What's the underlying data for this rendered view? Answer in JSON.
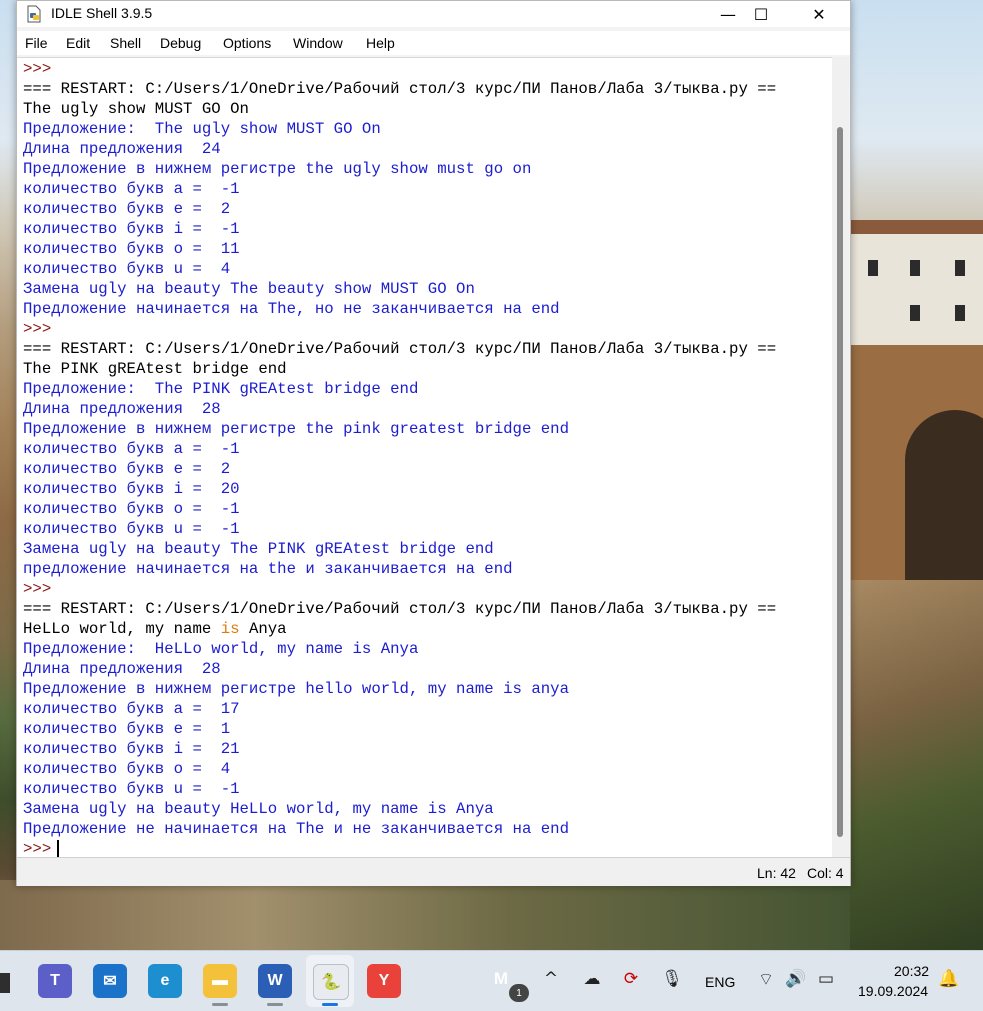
{
  "window": {
    "title": "IDLE Shell 3.9.5",
    "controls": {
      "minimize": "—",
      "maximize": "☐",
      "close": "✕"
    }
  },
  "menu": [
    "File",
    "Edit",
    "Shell",
    "Debug",
    "Options",
    "Window",
    "Help"
  ],
  "shell": {
    "lines": [
      {
        "type": "prompt",
        "text": ">>>"
      },
      {
        "type": "restart",
        "text": "=== RESTART: C:/Users/1/OneDrive/Рабочий стол/3 курс/ПИ Панов/Лаба 3/тыква.py =="
      },
      {
        "type": "input",
        "text": "The ugly show MUST GO On"
      },
      {
        "type": "out",
        "text": "Предложение:  The ugly show MUST GO On"
      },
      {
        "type": "out",
        "text": "Длина предложения  24"
      },
      {
        "type": "out",
        "text": "Предложение в нижнем регистре the ugly show must go on"
      },
      {
        "type": "out",
        "text": "количество букв а =  -1"
      },
      {
        "type": "out",
        "text": "количество букв е =  2"
      },
      {
        "type": "out",
        "text": "количество букв i =  -1"
      },
      {
        "type": "out",
        "text": "количество букв о =  11"
      },
      {
        "type": "out",
        "text": "количество букв u =  4"
      },
      {
        "type": "out",
        "text": "Замена ugly на beauty The beauty show MUST GO On"
      },
      {
        "type": "out",
        "text": "Предложение начинается на The, но не заканчивается на end"
      },
      {
        "type": "prompt",
        "text": ">>>"
      },
      {
        "type": "restart",
        "text": "=== RESTART: C:/Users/1/OneDrive/Рабочий стол/3 курс/ПИ Панов/Лаба 3/тыква.py =="
      },
      {
        "type": "input",
        "text": "The PINK gREAtest bridge end"
      },
      {
        "type": "out",
        "text": "Предложение:  The PINK gREAtest bridge end"
      },
      {
        "type": "out",
        "text": "Длина предложения  28"
      },
      {
        "type": "out",
        "text": "Предложение в нижнем регистре the pink greatest bridge end"
      },
      {
        "type": "out",
        "text": "количество букв а =  -1"
      },
      {
        "type": "out",
        "text": "количество букв е =  2"
      },
      {
        "type": "out",
        "text": "количество букв i =  20"
      },
      {
        "type": "out",
        "text": "количество букв о =  -1"
      },
      {
        "type": "out",
        "text": "количество букв u =  -1"
      },
      {
        "type": "out",
        "text": "Замена ugly на beauty The PINK gREAtest bridge end"
      },
      {
        "type": "out",
        "text": "предложение начинается на the и заканчивается на end"
      },
      {
        "type": "prompt",
        "text": ">>>"
      },
      {
        "type": "restart",
        "text": "=== RESTART: C:/Users/1/OneDrive/Рабочий стол/3 курс/ПИ Панов/Лаба 3/тыква.py =="
      },
      {
        "type": "input-kw",
        "before": "HeLLo world, my name ",
        "kw": "is",
        "after": " Anya"
      },
      {
        "type": "out",
        "text": "Предложение:  HeLLo world, my name is Anya"
      },
      {
        "type": "out",
        "text": "Длина предложения  28"
      },
      {
        "type": "out",
        "text": "Предложение в нижнем регистре hello world, my name is anya"
      },
      {
        "type": "out",
        "text": "количество букв а =  17"
      },
      {
        "type": "out",
        "text": "количество букв е =  1"
      },
      {
        "type": "out",
        "text": "количество букв i =  21"
      },
      {
        "type": "out",
        "text": "количество букв о =  4"
      },
      {
        "type": "out",
        "text": "количество букв u =  -1"
      },
      {
        "type": "out",
        "text": "Замена ugly на beauty HeLLo world, my name is Anya"
      },
      {
        "type": "out",
        "text": "Предложение не начинается на The и не заканчивается на end"
      },
      {
        "type": "prompt-cursor",
        "text": ">>>"
      }
    ]
  },
  "status": {
    "ln": "Ln: 42",
    "col": "Col: 4"
  },
  "taskbar": {
    "apps": [
      {
        "name": "teams-icon",
        "label": "T",
        "color": "#5b5fc7"
      },
      {
        "name": "mail-icon",
        "label": "✉",
        "color": "#1a73c9"
      },
      {
        "name": "edge-icon",
        "label": "e",
        "color": "#1d8fd0"
      },
      {
        "name": "explorer-icon",
        "label": "▬",
        "color": "#f3c13a"
      },
      {
        "name": "word-icon",
        "label": "W",
        "color": "#2b5fb5"
      },
      {
        "name": "idle-icon",
        "label": "🐍",
        "color": "#e8ecf0"
      },
      {
        "name": "yandex-icon",
        "label": "Y",
        "color": "#e9423a"
      }
    ],
    "tray": {
      "notification_count": "1",
      "language": "ENG",
      "time": "20:32",
      "date": "19.09.2024"
    }
  }
}
